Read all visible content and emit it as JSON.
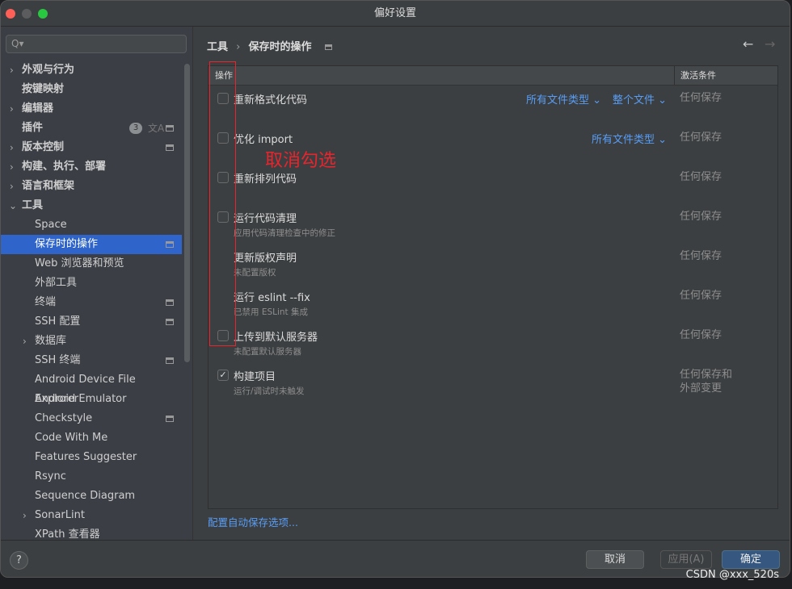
{
  "window": {
    "title": "偏好设置"
  },
  "sidebar": {
    "search_placeholder": "Q▾",
    "plugin_badge": "3",
    "items": [
      {
        "label": "外观与行为"
      },
      {
        "label": "按键映射"
      },
      {
        "label": "编辑器"
      },
      {
        "label": "插件"
      },
      {
        "label": "版本控制"
      },
      {
        "label": "构建、执行、部署"
      },
      {
        "label": "语言和框架"
      },
      {
        "label": "工具"
      },
      {
        "label": "Space"
      },
      {
        "label": "保存时的操作"
      },
      {
        "label": "Web 浏览器和预览"
      },
      {
        "label": "外部工具"
      },
      {
        "label": "终端"
      },
      {
        "label": "SSH 配置"
      },
      {
        "label": "数据库"
      },
      {
        "label": "SSH 终端"
      },
      {
        "label": "Android Device File Explorer"
      },
      {
        "label": "Android Emulator"
      },
      {
        "label": "Checkstyle"
      },
      {
        "label": "Code With Me"
      },
      {
        "label": "Features Suggester"
      },
      {
        "label": "Rsync"
      },
      {
        "label": "Sequence Diagram"
      },
      {
        "label": "SonarLint"
      },
      {
        "label": "XPath 查看器"
      }
    ]
  },
  "breadcrumb": {
    "parent": "工具",
    "sep": "›",
    "current": "保存时的操作"
  },
  "table": {
    "col_action": "操作",
    "col_condition": "激活条件",
    "rows": [
      {
        "name": "重新格式化代码",
        "checkbox": true,
        "checked": false,
        "links": [
          "所有文件类型 ⌄",
          "整个文件 ⌄"
        ],
        "condition": "任何保存"
      },
      {
        "name": "优化 import",
        "checkbox": true,
        "checked": false,
        "links": [
          "所有文件类型 ⌄"
        ],
        "condition": "任何保存"
      },
      {
        "name": "重新排列代码",
        "checkbox": true,
        "checked": false,
        "condition": "任何保存"
      },
      {
        "name": "运行代码清理",
        "sub": "应用代码清理检查中的修正",
        "checkbox": true,
        "checked": false,
        "condition": "任何保存"
      },
      {
        "name": "更新版权声明",
        "sub": "未配置版权",
        "checkbox": false,
        "condition": "任何保存"
      },
      {
        "name": "运行 eslint --fix",
        "sub": "已禁用 ESLint 集成",
        "checkbox": false,
        "condition": "任何保存"
      },
      {
        "name": "上传到默认服务器",
        "sub": "未配置默认服务器",
        "checkbox": true,
        "checked": false,
        "condition": "任何保存"
      },
      {
        "name": "构建项目",
        "sub": "运行/调试时未触发",
        "checkbox": true,
        "checked": true,
        "condition": "任何保存和\n外部变更"
      }
    ]
  },
  "annotation": {
    "text": "取消勾选",
    "color": "#e8242c"
  },
  "configure_link": "配置自动保存选项...",
  "buttons": {
    "help": "?",
    "cancel": "取消",
    "apply": "应用(A)",
    "ok": "确定"
  },
  "watermark": "CSDN @xxx_520s"
}
